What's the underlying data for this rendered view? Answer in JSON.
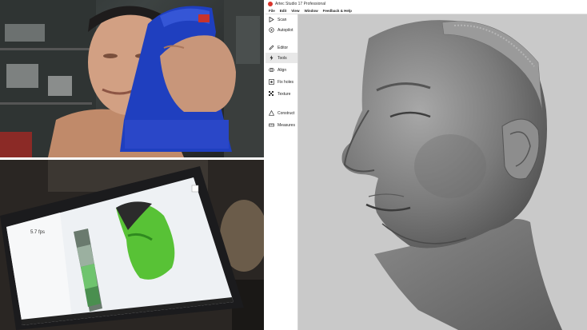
{
  "app": {
    "title": "Artec Studio 17 Professional",
    "accent": "#d9342b",
    "viewport_bg": "#c9c9c9"
  },
  "menu": [
    "File",
    "Edit",
    "View",
    "Window",
    "Feedback & Help"
  ],
  "tools": [
    {
      "label": "Scan",
      "icon": "play-icon"
    },
    {
      "label": "Autopilot",
      "icon": "autopilot-icon"
    },
    {
      "label": "Editor",
      "icon": "pencil-icon"
    },
    {
      "label": "Tools",
      "icon": "lightning-icon",
      "active": true
    },
    {
      "label": "Align",
      "icon": "align-icon"
    },
    {
      "label": "Fix holes",
      "icon": "fix-holes-icon"
    },
    {
      "label": "Texture",
      "icon": "texture-icon"
    },
    {
      "label": "Construct",
      "icon": "construct-icon"
    },
    {
      "label": "Measures",
      "icon": "measures-icon"
    }
  ],
  "laptop": {
    "readout": "5.7 fps"
  }
}
